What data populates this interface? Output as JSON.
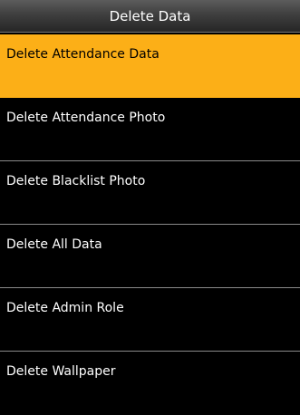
{
  "screen": {
    "title": "Delete Data",
    "background_color": "#000000",
    "highlight_color": "#fcaf17"
  },
  "menu": {
    "items": [
      {
        "label": "Delete Attendance Data",
        "selected": true
      },
      {
        "label": "Delete Attendance Photo",
        "selected": false
      },
      {
        "label": "Delete Blacklist Photo",
        "selected": false
      },
      {
        "label": "Delete All Data",
        "selected": false
      },
      {
        "label": "Delete Admin Role",
        "selected": false
      },
      {
        "label": "Delete Wallpaper",
        "selected": false
      }
    ]
  }
}
